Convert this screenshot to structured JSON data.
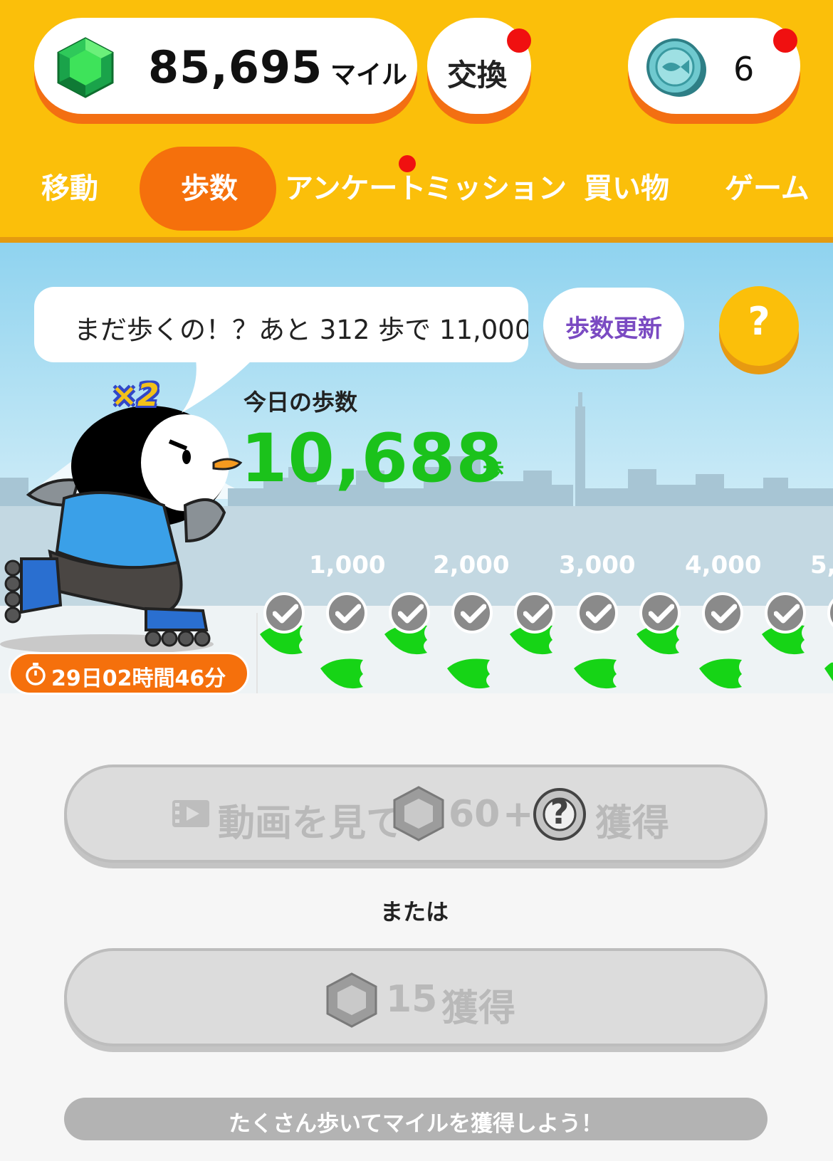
{
  "header": {
    "miles_value": "85,695",
    "miles_unit": "マイル",
    "exchange_label": "交換",
    "coin_count": "6",
    "icons": [
      "gem-icon",
      "fish-coin-icon"
    ]
  },
  "tabs": [
    {
      "label": "移動",
      "active": false
    },
    {
      "label": "歩数",
      "active": true
    },
    {
      "label": "アンケート",
      "active": false,
      "badge": true
    },
    {
      "label": "ミッション",
      "active": false
    },
    {
      "label": "買い物",
      "active": false
    },
    {
      "label": "ゲーム",
      "active": false
    }
  ],
  "scene": {
    "bubble_text": "まだ歩くの！？あと 312 歩で 11,000",
    "update_button": "歩数更新",
    "help_button": "?",
    "multiplier": "×2",
    "today_label": "今日の歩数",
    "today_value": "10,688",
    "today_unit": "歩",
    "milestones": [
      "1,000",
      "2,000",
      "3,000",
      "4,000",
      "5,"
    ],
    "timer": "29日02時間46分"
  },
  "actions": {
    "video_button": {
      "text_1": "動画を見て",
      "amount": "60",
      "plus": "+",
      "question": "?",
      "suffix": "獲得"
    },
    "or_label": "または",
    "claim_button": {
      "amount": "15",
      "suffix": "獲得"
    },
    "banner": "たくさん歩いてマイルを獲得しよう！"
  },
  "colors": {
    "header_bg": "#fbbf0a",
    "accent_orange": "#f5700c",
    "steps_green": "#1bc21b",
    "badge_red": "#f01010"
  }
}
